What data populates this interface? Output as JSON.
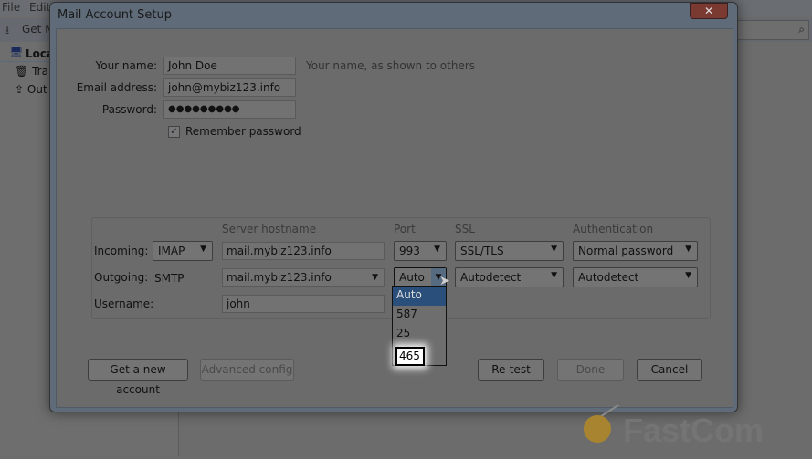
{
  "app": {
    "menu": [
      "File",
      "Edit"
    ],
    "toolbar_get": "Get M",
    "folders": [
      {
        "label": "Loca",
        "icon": "computer-icon"
      },
      {
        "label": "Tra",
        "icon": "trash-icon"
      },
      {
        "label": "Out",
        "icon": "outbox-icon"
      }
    ]
  },
  "dialog": {
    "title": "Mail Account Setup",
    "name_label": "Your name:",
    "name_value": "John Doe",
    "name_hint": "Your name, as shown to others",
    "email_label": "Email address:",
    "email_value": "john@mybiz123.info",
    "password_label": "Password:",
    "password_value": "●●●●●●●●●",
    "remember_label": "Remember password",
    "remember_checked": true,
    "headers": {
      "host": "Server hostname",
      "port": "Port",
      "ssl": "SSL",
      "auth": "Authentication"
    },
    "incoming": {
      "label": "Incoming:",
      "protocol": "IMAP",
      "host": "mail.mybiz123.info",
      "port": "993",
      "ssl": "SSL/TLS",
      "auth": "Normal password"
    },
    "outgoing": {
      "label": "Outgoing:",
      "protocol": "SMTP",
      "host": "mail.mybiz123.info",
      "port": "Auto",
      "ssl": "Autodetect",
      "auth": "Autodetect"
    },
    "username": {
      "label": "Username:",
      "value": "john"
    },
    "port_options": [
      "Auto",
      "587",
      "25",
      "465"
    ],
    "port_highlighted": "Auto",
    "port_emphasized": "465",
    "buttons": {
      "new_account": "Get a new account",
      "advanced": "Advanced config",
      "retest": "Re-test",
      "done": "Done",
      "cancel": "Cancel"
    }
  },
  "watermark": "FastComet",
  "colors": {
    "dim_overlay": "#6c6c6c",
    "highlight": "#2a4f7a"
  }
}
